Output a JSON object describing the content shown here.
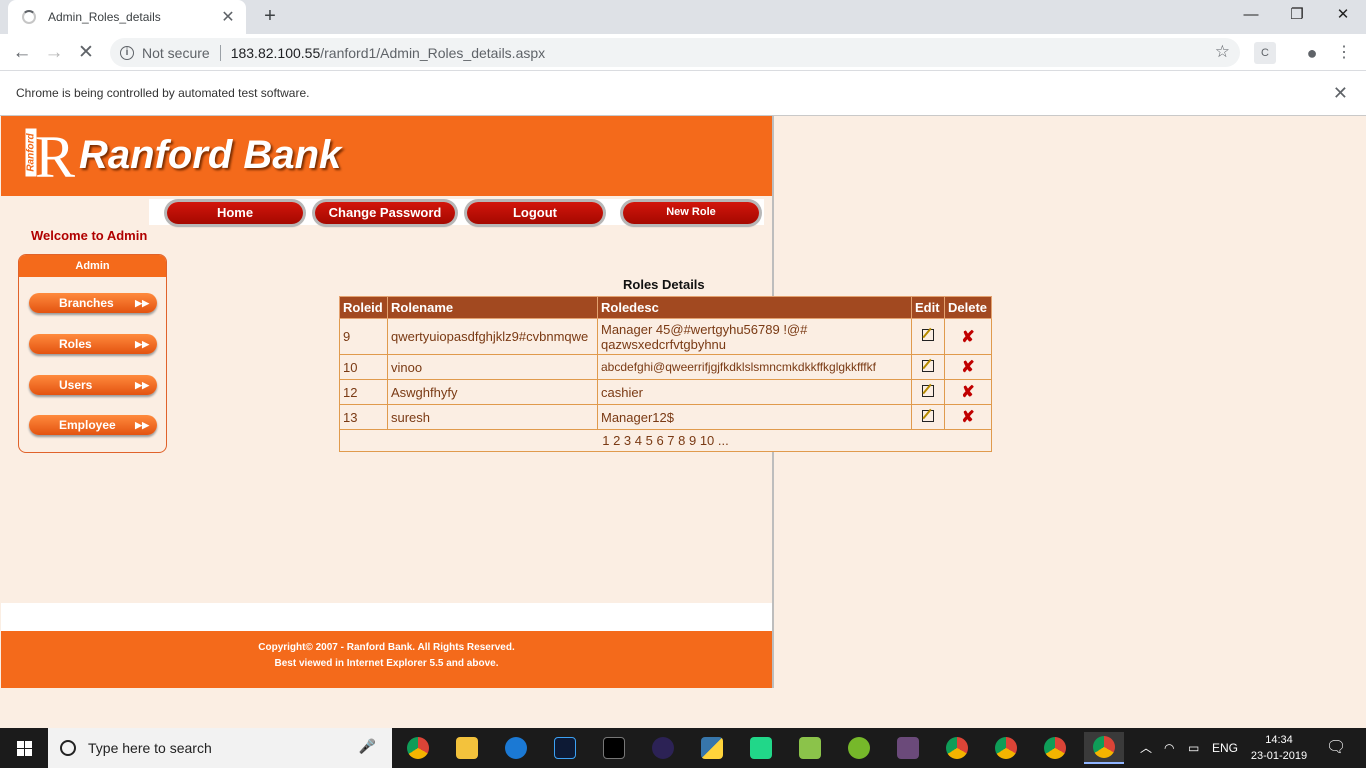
{
  "browser": {
    "tab_title": "Admin_Roles_details",
    "new_tab": "+",
    "address_security": "Not secure",
    "url_host": "183.82.100.55",
    "url_path": "/ranford1/Admin_Roles_details.aspx",
    "infobar_text": "Chrome is being controlled by automated test software.",
    "window_controls": [
      "—",
      "❐",
      "✕"
    ]
  },
  "site": {
    "logo_text": "Ranford",
    "brand": "Ranford Bank",
    "menu": [
      {
        "label": "Home"
      },
      {
        "label": "Change Password"
      },
      {
        "label": "Logout"
      },
      {
        "label": "New Role"
      }
    ],
    "welcome": "Welcome to Admin",
    "sidebar": {
      "title": "Admin",
      "items": [
        {
          "label": "Branches"
        },
        {
          "label": "Roles"
        },
        {
          "label": "Users"
        },
        {
          "label": "Employee"
        }
      ]
    },
    "grid": {
      "title": "Roles Details",
      "columns": [
        "Roleid",
        "Rolename",
        "Roledesc",
        "Edit",
        "Delete"
      ],
      "rows": [
        {
          "id": "9",
          "name": "qwertyuiopasdfghjklz9#cvbnmqwe",
          "desc": "Manager 45@#wertgyhu56789 !@# qazwsxedcrfvtgbyhnu"
        },
        {
          "id": "10",
          "name": "vinoo",
          "desc": "abcdefghi@qweerrifjgjfkdklslsmncmkdkkffkglgkkfffkf"
        },
        {
          "id": "12",
          "name": "Aswghfhyfy",
          "desc": "cashier"
        },
        {
          "id": "13",
          "name": "suresh",
          "desc": "Manager12$"
        }
      ],
      "pager": "1 2 3 4 5 6 7 8 9 10 ..."
    },
    "footer": {
      "line1": "Copyright© 2007 - Ranford Bank. All Rights Reserved.",
      "line2": "Best viewed in Internet Explorer 5.5 and above."
    }
  },
  "taskbar": {
    "search_placeholder": "Type here to search",
    "language": "ENG",
    "time": "14:34",
    "date": "23-01-2019"
  }
}
